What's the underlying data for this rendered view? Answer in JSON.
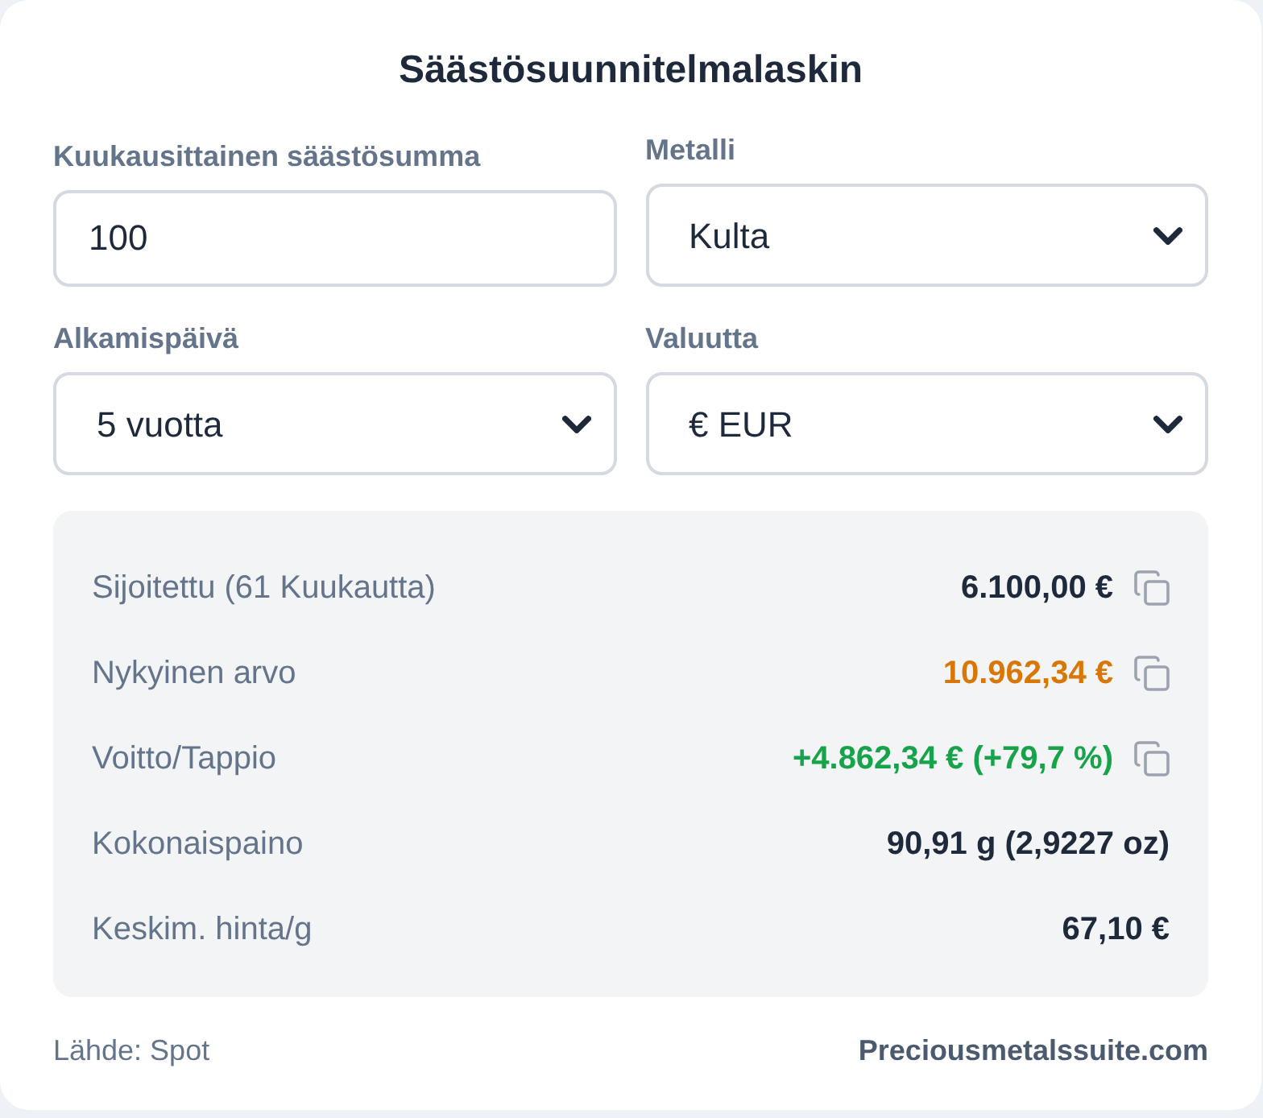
{
  "title": "Säästösuunnitelmalaskin",
  "fields": [
    {
      "kind": "input",
      "label": "Kuukausittainen säästösumma",
      "value": "100"
    },
    {
      "kind": "select",
      "label": "Metalli",
      "value": "Kulta"
    },
    {
      "kind": "select",
      "label": "Alkamispäivä",
      "value": "5 vuotta"
    },
    {
      "kind": "select",
      "label": "Valuutta",
      "value": "€ EUR"
    }
  ],
  "results": [
    {
      "label": "Sijoitettu (61 Kuukautta)",
      "value": "6.100,00 €",
      "color": "#1e293b",
      "copyable": true
    },
    {
      "label": "Nykyinen arvo",
      "value": "10.962,34 €",
      "color": "#d97706",
      "copyable": true
    },
    {
      "label": "Voitto/Tappio",
      "value": "+4.862,34 € (+79,7 %)",
      "color": "#16a34a",
      "copyable": true
    },
    {
      "label": "Kokonaispaino",
      "value": "90,91 g (2,9227 oz)",
      "color": "#1e293b",
      "copyable": false
    },
    {
      "label": "Keskim. hinta/g",
      "value": "67,10 €",
      "color": "#1e293b",
      "copyable": false
    }
  ],
  "footer": {
    "source": "Lähde: Spot",
    "website": "Preciousmetalssuite.com"
  }
}
